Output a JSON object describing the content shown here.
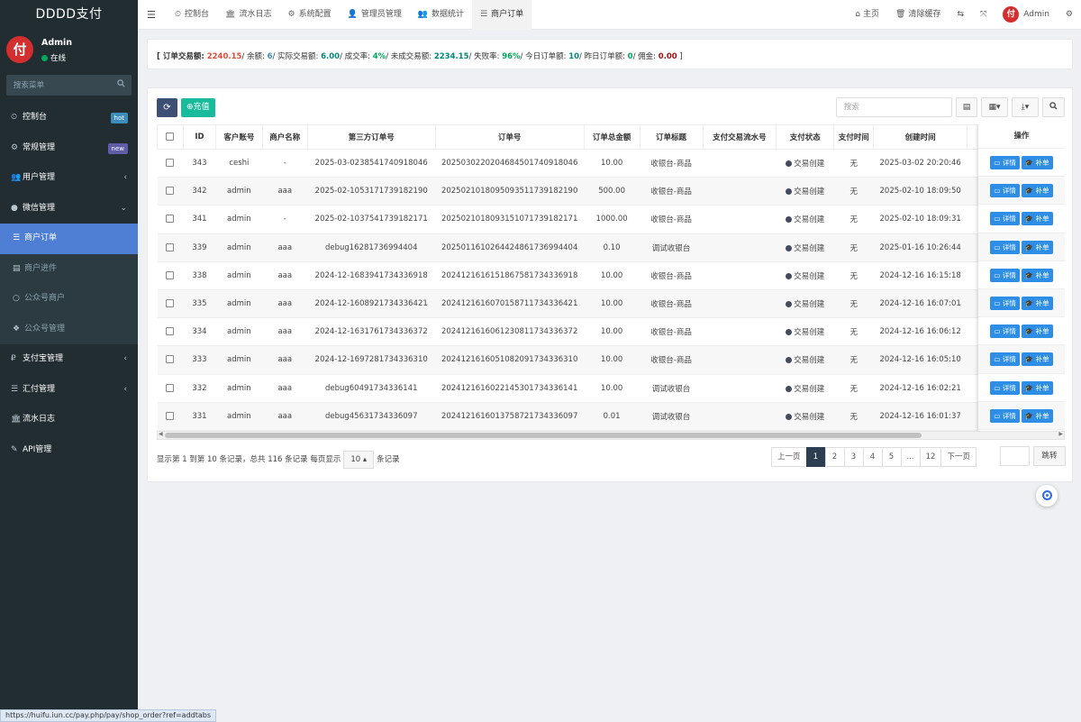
{
  "brand": "DDDD支付",
  "user": {
    "avatar_glyph": "付",
    "name": "Admin",
    "status": "在线"
  },
  "sidebar_search_placeholder": "搜索菜单",
  "menu": [
    {
      "icon": "dashboard-icon",
      "glyph": "⏲",
      "label": "控制台",
      "badge": "hot",
      "badge_color": "#3c8dbc"
    },
    {
      "icon": "cogs-icon",
      "glyph": "⚙",
      "label": "常规管理",
      "badge": "new",
      "badge_color": "#605ca8"
    },
    {
      "icon": "users-icon",
      "glyph": "👥",
      "label": "用户管理",
      "caret": "‹"
    },
    {
      "icon": "wechat-icon",
      "glyph": "●",
      "label": "微信管理",
      "caret": "⌄"
    }
  ],
  "submenu": [
    {
      "icon": "list-icon",
      "glyph": "☰",
      "label": "商户订单",
      "active": true
    },
    {
      "icon": "file-icon",
      "glyph": "▤",
      "label": "商户进件"
    },
    {
      "icon": "circle-icon",
      "glyph": "○",
      "label": "公众号商户"
    },
    {
      "icon": "cube-icon",
      "glyph": "❖",
      "label": "公众号管理"
    }
  ],
  "menu2": [
    {
      "icon": "paypal-icon",
      "glyph": "₽",
      "label": "支付宝管理",
      "caret": "‹"
    },
    {
      "icon": "list-icon",
      "glyph": "☰",
      "label": "汇付管理",
      "caret": "‹"
    },
    {
      "icon": "bank-icon",
      "glyph": "🏛",
      "label": "流水日志"
    },
    {
      "icon": "wrench-icon",
      "glyph": "✎",
      "label": "API管理"
    }
  ],
  "tabs": [
    {
      "icon": "dashboard-icon",
      "glyph": "⏲",
      "label": "控制台"
    },
    {
      "icon": "bank-icon",
      "glyph": "🏛",
      "label": "流水日志"
    },
    {
      "icon": "cog-icon",
      "glyph": "⚙",
      "label": "系统配置"
    },
    {
      "icon": "user-icon",
      "glyph": "👤",
      "label": "管理员管理"
    },
    {
      "icon": "users-icon",
      "glyph": "👥",
      "label": "数据统计"
    },
    {
      "icon": "list-icon",
      "glyph": "☰",
      "label": "商户订单",
      "active": true
    }
  ],
  "nav_right": {
    "home": "主页",
    "clear_cache": "清除缓存",
    "admin": "Admin"
  },
  "summary": {
    "p1": "[ 订单交易额: ",
    "total": "2240.15",
    "p2": "/ 余额: ",
    "balance": "6",
    "p3": "/ 实际交易额: ",
    "actual": "6.00",
    "p4": "/ 成交率: ",
    "rate": "4%",
    "p5": "/ 未成交易额: ",
    "unpaid": "2234.15",
    "p6": "/ 失败率: ",
    "fail": "96%",
    "p7": "/ 今日订单额: ",
    "today": "10",
    "p8": "/ 昨日订单额: ",
    "yesterday": "0",
    "p9": "/ 佣金: ",
    "commission": "0.00",
    "p10": " ]"
  },
  "toolbar": {
    "recharge": "充值",
    "search_placeholder": "搜索"
  },
  "columns": [
    "ID",
    "客户账号",
    "商户名称",
    "第三方订单号",
    "订单号",
    "订单总金额",
    "订单标题",
    "支付交易流水号",
    "支付状态",
    "支付时间",
    "创建时间"
  ],
  "op_header": "操作",
  "op_detail": "详情",
  "op_supplement": "补单",
  "rows": [
    [
      "343",
      "ceshi",
      "-",
      "2025-03-0238541740918046",
      "20250302202046845017409180​46",
      "10.00",
      "收银台-商品",
      "",
      "交易创建",
      "无",
      "2025-03-02 20:20:46"
    ],
    [
      "342",
      "admin",
      "aaa",
      "2025-02-1053171739182190",
      "202502101809509351173918219​0",
      "500.00",
      "收银台-商品",
      "",
      "交易创建",
      "无",
      "2025-02-10 18:09:50"
    ],
    [
      "341",
      "admin",
      "-",
      "2025-02-1037541739182171",
      "202502101809315107173918217​1",
      "1000.00",
      "收银台-商品",
      "",
      "交易创建",
      "无",
      "2025-02-10 18:09:31"
    ],
    [
      "339",
      "admin",
      "aaa",
      "debug16281736994404",
      "202501161026442486173699440​4",
      "0.10",
      "调试收银台",
      "",
      "交易创建",
      "无",
      "2025-01-16 10:26:44"
    ],
    [
      "338",
      "admin",
      "aaa",
      "2024-12-1683941734336918",
      "202412161615186758173433691​8",
      "10.00",
      "收银台-商品",
      "",
      "交易创建",
      "无",
      "2024-12-16 16:15:18"
    ],
    [
      "335",
      "admin",
      "aaa",
      "2024-12-1608921734336421",
      "202412161607015871173433642​1",
      "10.00",
      "收银台-商品",
      "",
      "交易创建",
      "无",
      "2024-12-16 16:07:01"
    ],
    [
      "334",
      "admin",
      "aaa",
      "2024-12-1631761734336372",
      "202412161606123081173433637​2",
      "10.00",
      "收银台-商品",
      "",
      "交易创建",
      "无",
      "2024-12-16 16:06:12"
    ],
    [
      "333",
      "admin",
      "aaa",
      "2024-12-1697281734336310",
      "202412161605108209173433631​0",
      "10.00",
      "收银台-商品",
      "",
      "交易创建",
      "无",
      "2024-12-16 16:05:10"
    ],
    [
      "332",
      "admin",
      "aaa",
      "debug60491734336141",
      "202412161602214530173433614​1",
      "10.00",
      "调试收银台",
      "",
      "交易创建",
      "无",
      "2024-12-16 16:02:21"
    ],
    [
      "331",
      "admin",
      "aaa",
      "debug45631734336097",
      "202412161601375872173433609​7",
      "0.01",
      "调试收银台",
      "",
      "交易创建",
      "无",
      "2024-12-16 16:01:37"
    ]
  ],
  "pagination": {
    "info_prefix": "显示第 1 到第 10 条记录，总共 116 条记录 每页显示",
    "page_size": "10 ▴",
    "info_suffix": "条记录",
    "prev": "上一页",
    "next": "下一页",
    "pages": [
      "1",
      "2",
      "3",
      "4",
      "5",
      "...",
      "12"
    ],
    "jump": "跳转"
  },
  "status_url": "https://huifu.iun.cc/pay.php/pay/shop_order?ref=addtabs"
}
